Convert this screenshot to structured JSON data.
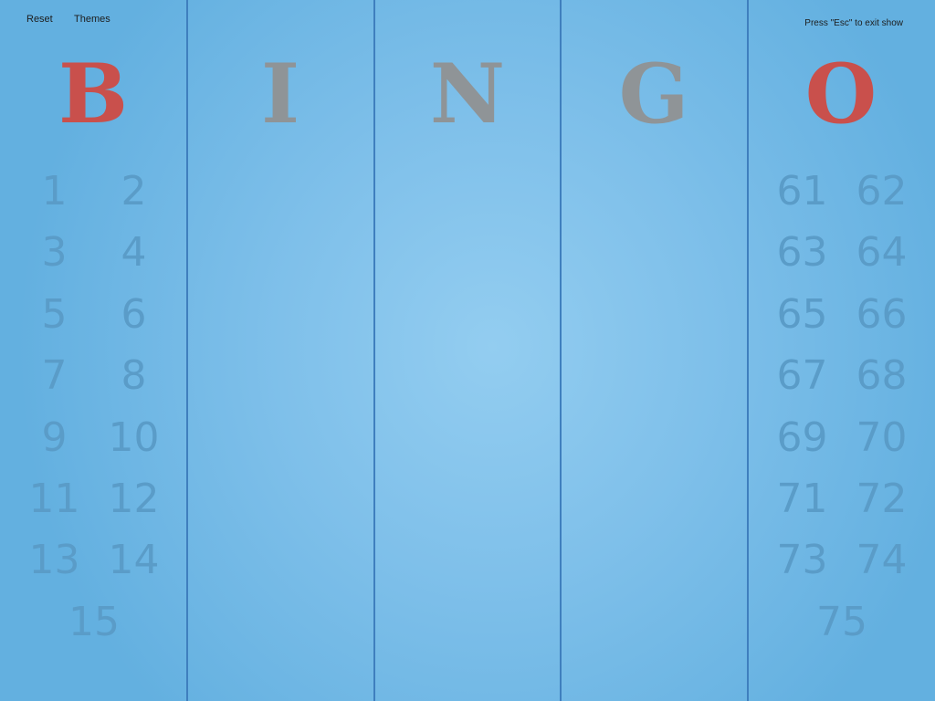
{
  "toolbar": {
    "reset_label": "Reset",
    "themes_label": "Themes"
  },
  "hint": "Press \"Esc\" to exit show",
  "colors": {
    "called_letter": "#c9504c",
    "uncalled_letter": "#8f9497",
    "number": "#5a9cc8",
    "divider": "#3f7fbe"
  },
  "columns": [
    {
      "letter": "B",
      "letter_state": "red",
      "numbers": [
        "1",
        "2",
        "3",
        "4",
        "5",
        "6",
        "7",
        "8",
        "9",
        "10",
        "11",
        "12",
        "13",
        "14",
        "15"
      ]
    },
    {
      "letter": "I",
      "letter_state": "gray",
      "numbers": []
    },
    {
      "letter": "N",
      "letter_state": "gray",
      "numbers": []
    },
    {
      "letter": "G",
      "letter_state": "gray",
      "numbers": []
    },
    {
      "letter": "O",
      "letter_state": "red",
      "numbers": [
        "61",
        "62",
        "63",
        "64",
        "65",
        "66",
        "67",
        "68",
        "69",
        "70",
        "71",
        "72",
        "73",
        "74",
        "75"
      ]
    }
  ]
}
